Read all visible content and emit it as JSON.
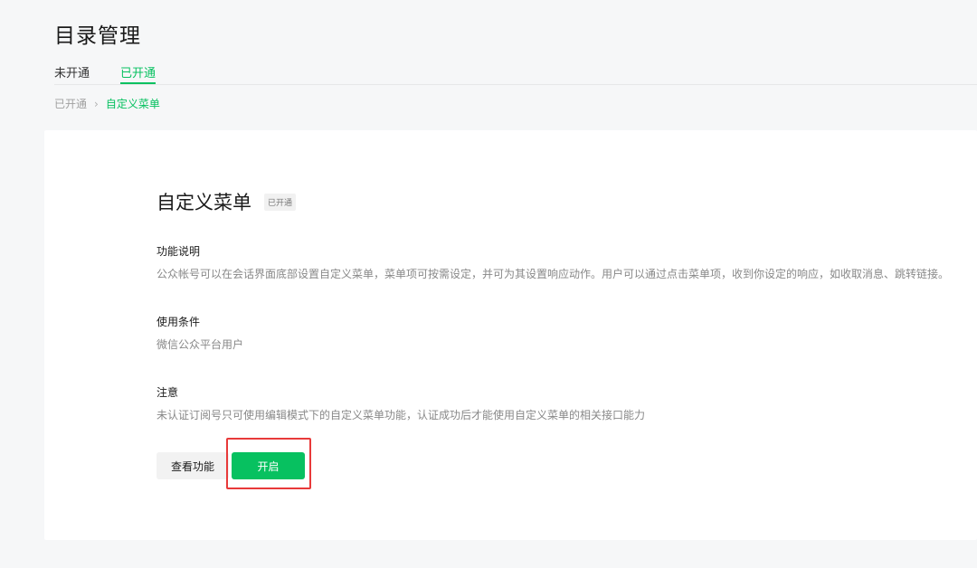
{
  "page": {
    "title": "目录管理"
  },
  "tabs": [
    {
      "label": "未开通",
      "active": false
    },
    {
      "label": "已开通",
      "active": true
    }
  ],
  "breadcrumb": {
    "parent": "已开通",
    "separator": "›",
    "current": "自定义菜单"
  },
  "feature": {
    "title": "自定义菜单",
    "status": "已开通",
    "sections": [
      {
        "title": "功能说明",
        "text": "公众帐号可以在会话界面底部设置自定义菜单，菜单项可按需设定，并可为其设置响应动作。用户可以通过点击菜单项，收到你设定的响应，如收取消息、跳转链接。"
      },
      {
        "title": "使用条件",
        "text": "微信公众平台用户"
      },
      {
        "title": "注意",
        "text": "未认证订阅号只可使用编辑模式下的自定义菜单功能，认证成功后才能使用自定义菜单的相关接口能力"
      }
    ],
    "buttons": {
      "view_label": "查看功能",
      "enable_label": "开启"
    }
  },
  "colors": {
    "accent": "#07c160",
    "highlight": "#e83a3a",
    "background": "#f6f7f8"
  }
}
